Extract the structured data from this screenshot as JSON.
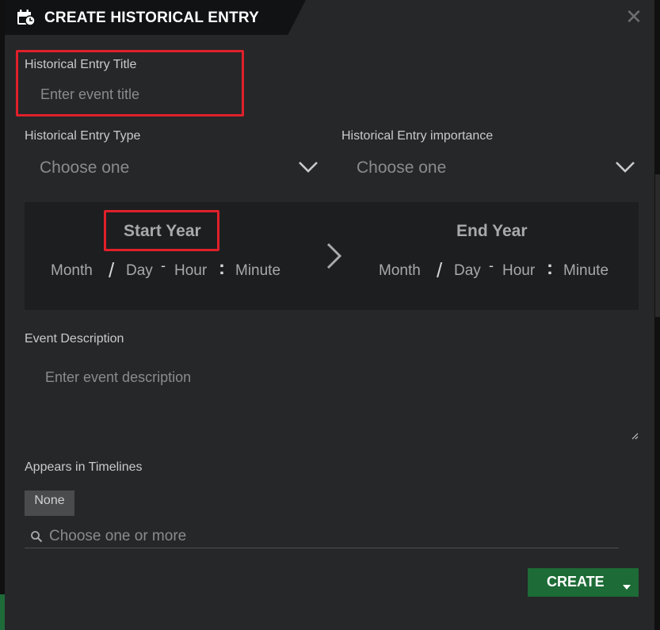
{
  "dialog": {
    "title": "CREATE HISTORICAL ENTRY",
    "close_glyph": "✕"
  },
  "entry_title": {
    "label": "Historical Entry Title",
    "placeholder": "Enter event title"
  },
  "entry_type": {
    "label": "Historical Entry Type",
    "value": "Choose one"
  },
  "entry_importance": {
    "label": "Historical Entry importance",
    "value": "Choose one"
  },
  "start": {
    "year_label": "Start Year",
    "month": "Month",
    "day": "Day",
    "hour": "Hour",
    "minute": "Minute"
  },
  "end": {
    "year_label": "End Year",
    "month": "Month",
    "day": "Day",
    "hour": "Hour",
    "minute": "Minute"
  },
  "separators": {
    "slash": "/",
    "dash": "-",
    "colon": ":"
  },
  "description": {
    "label": "Event Description",
    "placeholder": "Enter event description"
  },
  "timelines": {
    "label": "Appears in Timelines",
    "chip": "None",
    "search_placeholder": "Choose one or more"
  },
  "create_button": {
    "label": "CREATE"
  },
  "colors": {
    "accent_green": "#1d6b36",
    "highlight_red": "#e0202a",
    "dialog_bg": "#262729"
  },
  "icons": {
    "title": "calendar-clock-icon",
    "close": "close-icon",
    "dropdown": "chevron-down-icon",
    "range_arrow": "chevron-right-icon",
    "search": "search-icon",
    "caret": "caret-down-icon"
  }
}
